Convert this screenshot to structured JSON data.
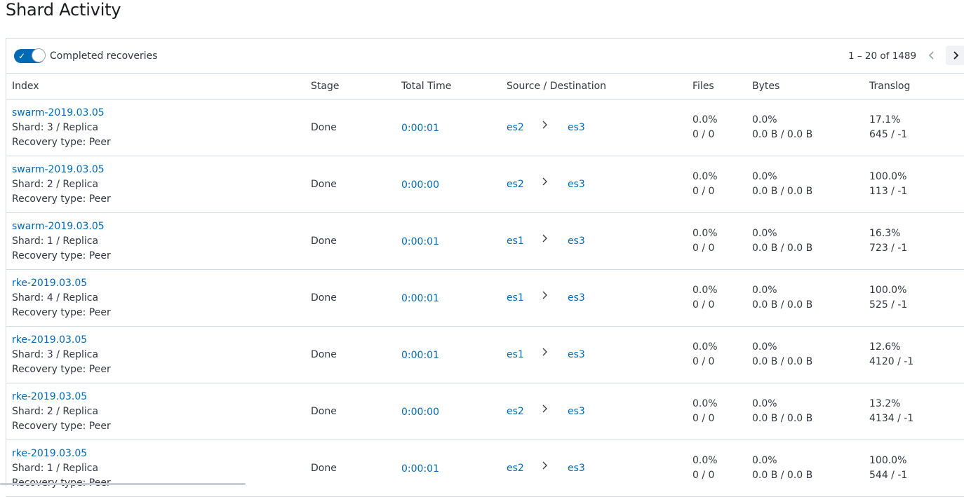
{
  "page": {
    "title": "Shard Activity"
  },
  "toolbar": {
    "switch_label": "Completed recoveries",
    "switch_checked": true,
    "pager_text": "1 – 20 of 1489"
  },
  "icons": {
    "check": "check-icon",
    "prev": "chevron-left-icon",
    "next": "chevron-right-icon",
    "arrow": "arrow-right-icon"
  },
  "colors": {
    "accent": "#006bb4",
    "text": "#343741",
    "border": "#d3dae6"
  },
  "columns": [
    "Index",
    "Stage",
    "Total Time",
    "Source / Destination",
    "Files",
    "Bytes",
    "Translog"
  ],
  "rows": [
    {
      "index": "swarm-2019.03.05",
      "shard": "Shard: 3 / Replica",
      "recovery": "Recovery type: Peer",
      "stage": "Done",
      "time": "0:00:01",
      "source": "es2",
      "destination": "es3",
      "files_pct": "0.0%",
      "files_count": "0 / 0",
      "bytes_pct": "0.0%",
      "bytes_size": "0.0 B / 0.0 B",
      "translog_pct": "17.1%",
      "translog_ops": "645 / -1"
    },
    {
      "index": "swarm-2019.03.05",
      "shard": "Shard: 2 / Replica",
      "recovery": "Recovery type: Peer",
      "stage": "Done",
      "time": "0:00:00",
      "source": "es2",
      "destination": "es3",
      "files_pct": "0.0%",
      "files_count": "0 / 0",
      "bytes_pct": "0.0%",
      "bytes_size": "0.0 B / 0.0 B",
      "translog_pct": "100.0%",
      "translog_ops": "113 / -1"
    },
    {
      "index": "swarm-2019.03.05",
      "shard": "Shard: 1 / Replica",
      "recovery": "Recovery type: Peer",
      "stage": "Done",
      "time": "0:00:01",
      "source": "es1",
      "destination": "es3",
      "files_pct": "0.0%",
      "files_count": "0 / 0",
      "bytes_pct": "0.0%",
      "bytes_size": "0.0 B / 0.0 B",
      "translog_pct": "16.3%",
      "translog_ops": "723 / -1"
    },
    {
      "index": "rke-2019.03.05",
      "shard": "Shard: 4 / Replica",
      "recovery": "Recovery type: Peer",
      "stage": "Done",
      "time": "0:00:01",
      "source": "es1",
      "destination": "es3",
      "files_pct": "0.0%",
      "files_count": "0 / 0",
      "bytes_pct": "0.0%",
      "bytes_size": "0.0 B / 0.0 B",
      "translog_pct": "100.0%",
      "translog_ops": "525 / -1"
    },
    {
      "index": "rke-2019.03.05",
      "shard": "Shard: 3 / Replica",
      "recovery": "Recovery type: Peer",
      "stage": "Done",
      "time": "0:00:01",
      "source": "es1",
      "destination": "es3",
      "files_pct": "0.0%",
      "files_count": "0 / 0",
      "bytes_pct": "0.0%",
      "bytes_size": "0.0 B / 0.0 B",
      "translog_pct": "12.6%",
      "translog_ops": "4120 / -1"
    },
    {
      "index": "rke-2019.03.05",
      "shard": "Shard: 2 / Replica",
      "recovery": "Recovery type: Peer",
      "stage": "Done",
      "time": "0:00:00",
      "source": "es2",
      "destination": "es3",
      "files_pct": "0.0%",
      "files_count": "0 / 0",
      "bytes_pct": "0.0%",
      "bytes_size": "0.0 B / 0.0 B",
      "translog_pct": "13.2%",
      "translog_ops": "4134 / -1"
    },
    {
      "index": "rke-2019.03.05",
      "shard": "Shard: 1 / Replica",
      "recovery": "Recovery type: Peer",
      "stage": "Done",
      "time": "0:00:01",
      "source": "es2",
      "destination": "es3",
      "files_pct": "0.0%",
      "files_count": "0 / 0",
      "bytes_pct": "0.0%",
      "bytes_size": "0.0 B / 0.0 B",
      "translog_pct": "100.0%",
      "translog_ops": "544 / -1"
    }
  ]
}
